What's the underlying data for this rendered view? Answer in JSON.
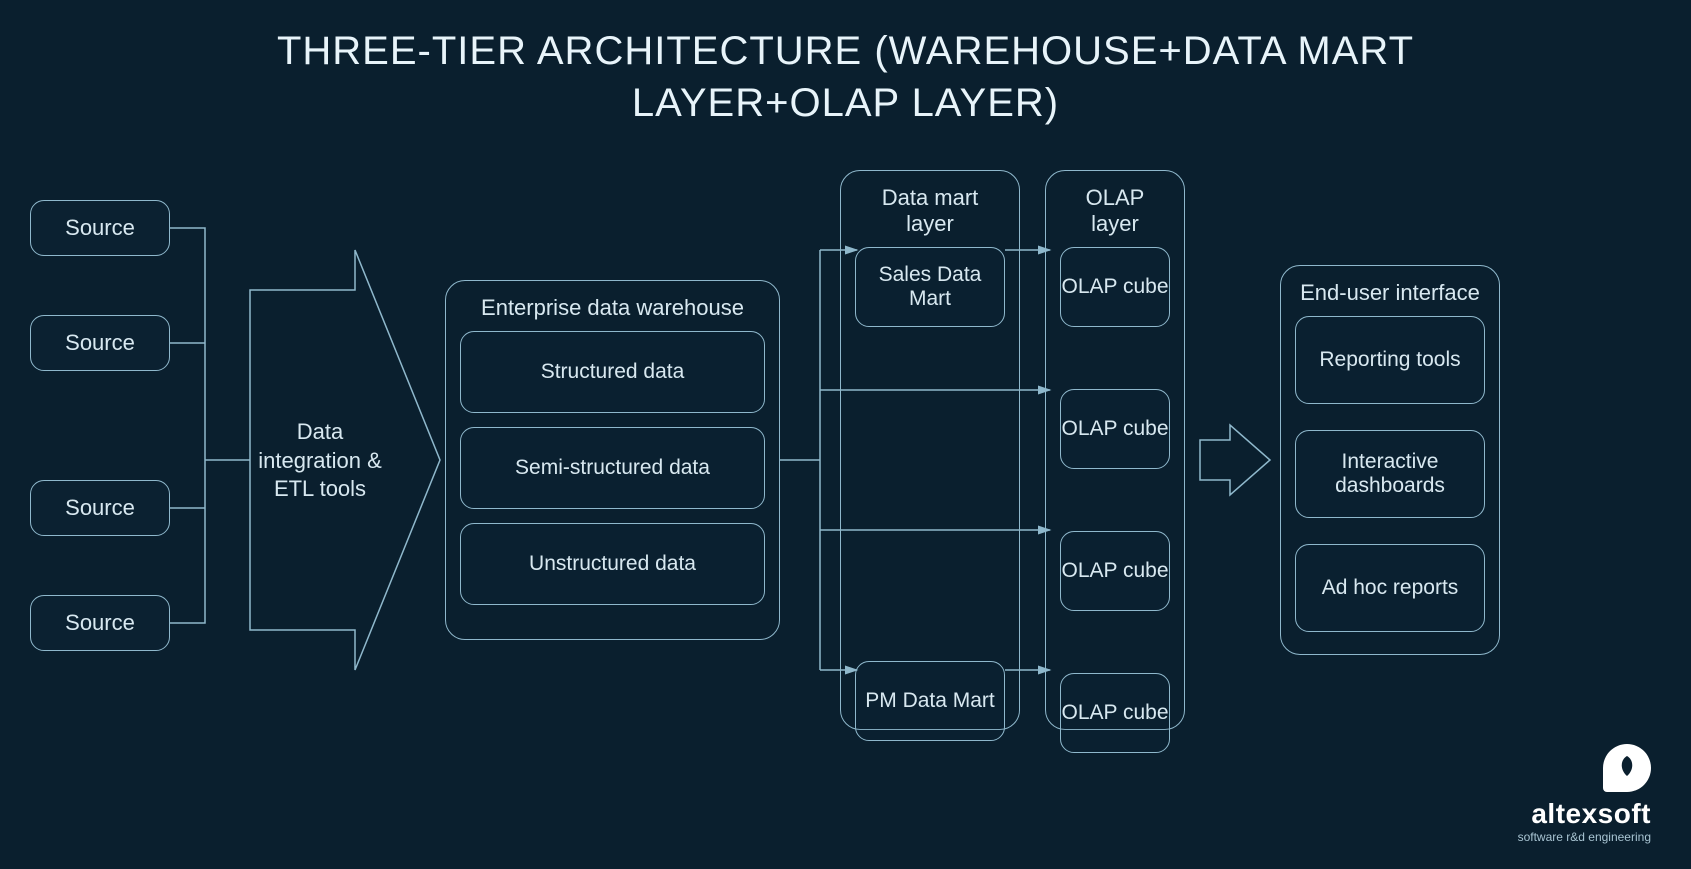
{
  "title_line1": "THREE-TIER ARCHITECTURE (WAREHOUSE+DATA MART",
  "title_line2": "LAYER+OLAP LAYER)",
  "sources": [
    "Source",
    "Source",
    "Source",
    "Source"
  ],
  "etl_label": "Data integration & ETL tools",
  "warehouse": {
    "title": "Enterprise data warehouse",
    "items": [
      "Structured data",
      "Semi-structured data",
      "Unstructured data"
    ]
  },
  "data_mart": {
    "title": "Data mart layer",
    "items": [
      "Sales Data Mart",
      "PM Data Mart"
    ]
  },
  "olap": {
    "title": "OLAP layer",
    "items": [
      "OLAP cube",
      "OLAP cube",
      "OLAP cube",
      "OLAP cube"
    ]
  },
  "end_user": {
    "title": "End-user interface",
    "items": [
      "Reporting tools",
      "Interactive dashboards",
      "Ad hoc reports"
    ]
  },
  "logo": {
    "name": "altexsoft",
    "tagline": "software r&d engineering"
  }
}
